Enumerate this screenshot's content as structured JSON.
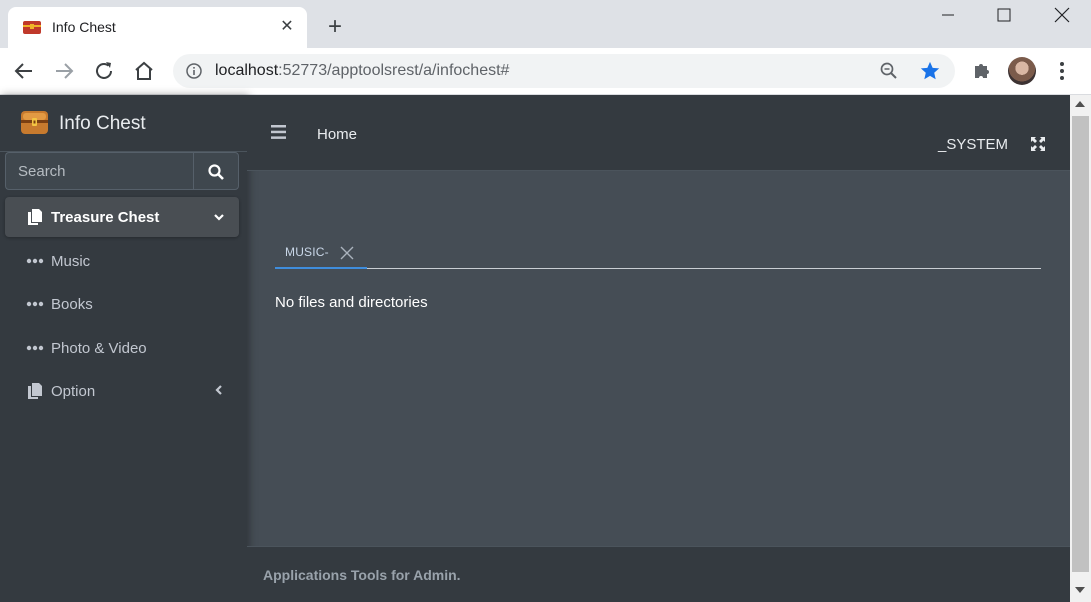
{
  "browser": {
    "tab_title": "Info Chest",
    "url_host": "localhost",
    "url_rest": ":52773/apptoolsrest/a/infochest#"
  },
  "app": {
    "brand": "Info Chest",
    "search_placeholder": "Search",
    "nav": [
      {
        "label": "Treasure Chest"
      },
      {
        "label": "Music"
      },
      {
        "label": "Books"
      },
      {
        "label": "Photo & Video"
      },
      {
        "label": "Option"
      }
    ],
    "header": {
      "home_label": "Home",
      "user": "_SYSTEM"
    },
    "content": {
      "tab_label": "MUSIC-",
      "empty_message": "No files and directories"
    },
    "footer": "Applications Tools for Admin."
  },
  "colors": {
    "sidebar": "#343a40",
    "content": "#454d55",
    "accent": "#3f8ddc",
    "star": "#1a73e8"
  },
  "icons": {
    "brand": "treasure-chest-icon",
    "search": "search-icon",
    "treasure": "copy-icon",
    "sub_item": "ellipsis-icon",
    "option": "copy-icon",
    "expand": "expand-arrows-icon",
    "menu": "hamburger-icon"
  }
}
